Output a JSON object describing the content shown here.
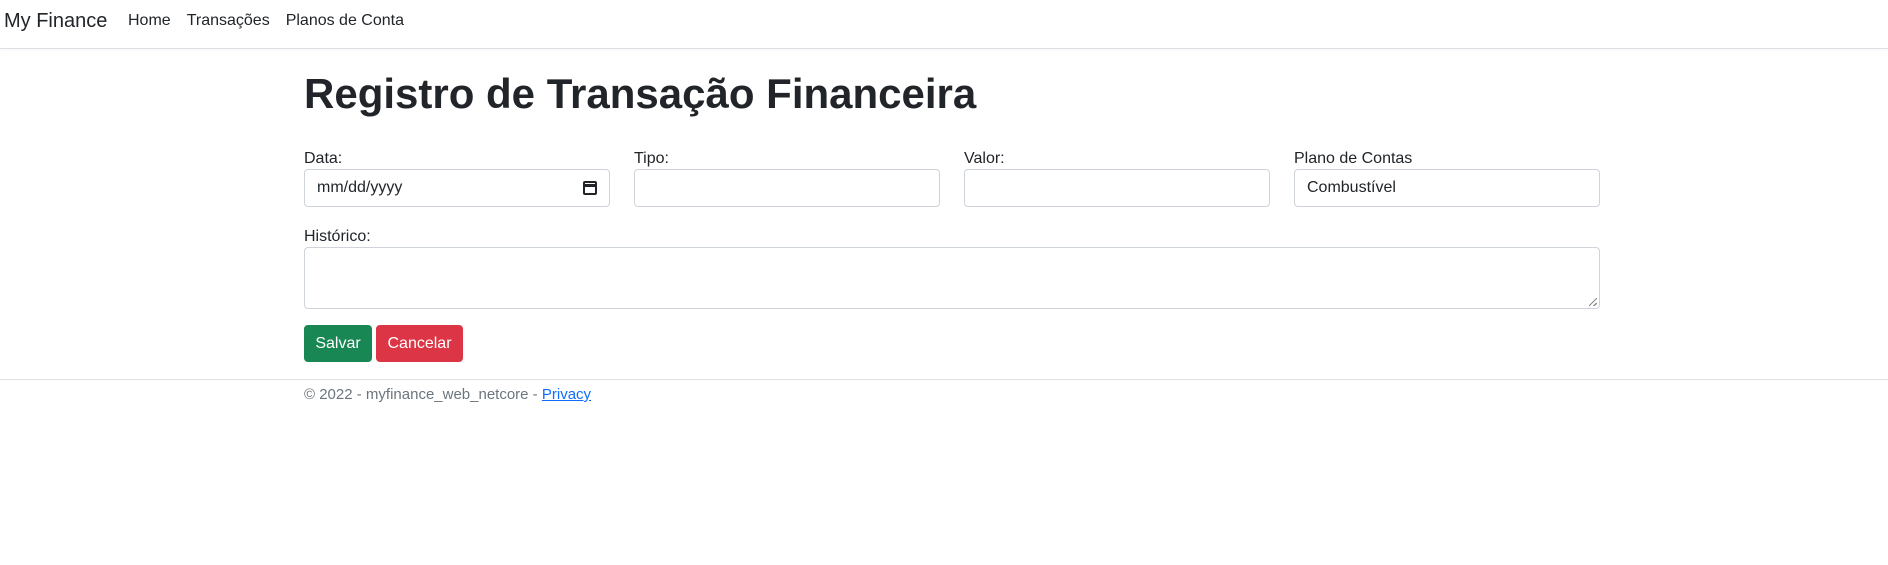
{
  "navbar": {
    "brand": "My Finance",
    "links": [
      "Home",
      "Transações",
      "Planos de Conta"
    ]
  },
  "main": {
    "title": "Registro de Transação Financeira",
    "fields": {
      "data": {
        "label": "Data:",
        "placeholder": "mm/dd/yyyy"
      },
      "tipo": {
        "label": "Tipo:",
        "value": ""
      },
      "valor": {
        "label": "Valor:",
        "value": ""
      },
      "plano": {
        "label": "Plano de Contas",
        "value": "Combustível"
      },
      "historico": {
        "label": "Histórico:",
        "value": ""
      }
    },
    "buttons": {
      "save": "Salvar",
      "cancel": "Cancelar"
    }
  },
  "footer": {
    "text": "© 2022 - myfinance_web_netcore - ",
    "link": "Privacy"
  },
  "colors": {
    "save": "#198754",
    "cancel": "#dc3545",
    "link": "#0d6efd"
  }
}
